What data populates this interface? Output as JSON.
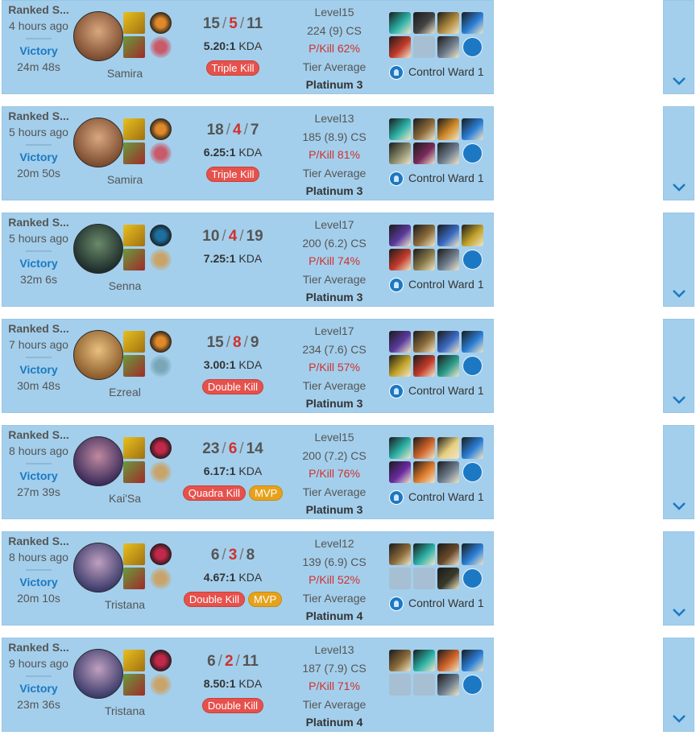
{
  "matches": [
    {
      "game_type": "Ranked S...",
      "time_ago": "4 hours ago",
      "result": "Victory",
      "length": "24m 48s",
      "champion": "Samira",
      "kills": "15",
      "deaths": "5",
      "assists": "11",
      "kda_ratio": "5.20:1",
      "kda_label": "KDA",
      "badges": [
        {
          "label": "Triple Kill",
          "kind": "multikill"
        }
      ],
      "level": "Level15",
      "cs": "224 (9) CS",
      "pkill": "P/Kill 62%",
      "tier_label": "Tier Average",
      "tier": "Platinum 3",
      "ward": "Control Ward 1",
      "spell_colors": [
        "#e8c020",
        "#6a9c3c"
      ],
      "rune_colors": [
        "#e0892a",
        "#c95a6a"
      ],
      "portrait_colors": [
        "#7a4a2e",
        "#d9a77f"
      ],
      "item_colors": [
        "#2bb0a5",
        "#444444",
        "#b08a3e",
        "#2b7fd6",
        "#c23a2a",
        "",
        "#6e7c8c"
      ]
    },
    {
      "game_type": "Ranked S...",
      "time_ago": "5 hours ago",
      "result": "Victory",
      "length": "20m 50s",
      "champion": "Samira",
      "kills": "18",
      "deaths": "4",
      "assists": "7",
      "kda_ratio": "6.25:1",
      "kda_label": "KDA",
      "badges": [
        {
          "label": "Triple Kill",
          "kind": "multikill"
        }
      ],
      "level": "Level13",
      "cs": "185 (8.9) CS",
      "pkill": "P/Kill 81%",
      "tier_label": "Tier Average",
      "tier": "Platinum 3",
      "ward": "Control Ward 1",
      "spell_colors": [
        "#e8c020",
        "#6a9c3c"
      ],
      "rune_colors": [
        "#e0892a",
        "#c95a6a"
      ],
      "portrait_colors": [
        "#7a4a2e",
        "#d9a77f"
      ],
      "item_colors": [
        "#2bb0a5",
        "#8a6a3a",
        "#d08a2a",
        "#2b7fd6",
        "#8a8a6a",
        "#7a2a5a",
        "#6e7c8c"
      ]
    },
    {
      "game_type": "Ranked S...",
      "time_ago": "5 hours ago",
      "result": "Victory",
      "length": "32m 6s",
      "champion": "Senna",
      "kills": "10",
      "deaths": "4",
      "assists": "19",
      "kda_ratio": "7.25:1",
      "kda_label": "KDA",
      "badges": [],
      "level": "Level17",
      "cs": "200 (6.2) CS",
      "pkill": "P/Kill 74%",
      "tier_label": "Tier Average",
      "tier": "Platinum 3",
      "ward": "Control Ward 1",
      "spell_colors": [
        "#e8c020",
        "#6a9c3c"
      ],
      "rune_colors": [
        "#1e6fa0",
        "#c9a46a"
      ],
      "portrait_colors": [
        "#1c2b2a",
        "#6a8a6a"
      ],
      "item_colors": [
        "#5a3a9c",
        "#8a6a3a",
        "#3a6ac2",
        "#c2a22a",
        "#c23a2a",
        "#8a7a4a",
        "#6e7c8c"
      ]
    },
    {
      "game_type": "Ranked S...",
      "time_ago": "7 hours ago",
      "result": "Victory",
      "length": "30m 48s",
      "champion": "Ezreal",
      "kills": "15",
      "deaths": "8",
      "assists": "9",
      "kda_ratio": "3.00:1",
      "kda_label": "KDA",
      "badges": [
        {
          "label": "Double Kill",
          "kind": "multikill"
        }
      ],
      "level": "Level17",
      "cs": "234 (7.6) CS",
      "pkill": "P/Kill 57%",
      "tier_label": "Tier Average",
      "tier": "Platinum 3",
      "ward": "Control Ward 1",
      "spell_colors": [
        "#e8c020",
        "#6a9c3c"
      ],
      "rune_colors": [
        "#e0892a",
        "#7aa6b8"
      ],
      "portrait_colors": [
        "#8a5a2a",
        "#e8c080"
      ],
      "item_colors": [
        "#5a3a9c",
        "#8a6a3a",
        "#3a6ac2",
        "#2b7fd6",
        "#c2a22a",
        "#c23a2a",
        "#2a9a8a"
      ]
    },
    {
      "game_type": "Ranked S...",
      "time_ago": "8 hours ago",
      "result": "Victory",
      "length": "27m 39s",
      "champion": "Kai'Sa",
      "kills": "23",
      "deaths": "6",
      "assists": "14",
      "kda_ratio": "6.17:1",
      "kda_label": "KDA",
      "badges": [
        {
          "label": "Quadra Kill",
          "kind": "multikill"
        },
        {
          "label": "MVP",
          "kind": "mvp"
        }
      ],
      "level": "Level15",
      "cs": "200 (7.2) CS",
      "pkill": "P/Kill 76%",
      "tier_label": "Tier Average",
      "tier": "Platinum 3",
      "ward": "Control Ward 1",
      "spell_colors": [
        "#e8c020",
        "#6a9c3c"
      ],
      "rune_colors": [
        "#c2284a",
        "#c9a46a"
      ],
      "portrait_colors": [
        "#3a2a5a",
        "#c08aa0"
      ],
      "item_colors": [
        "#2bb0a5",
        "#d0642a",
        "#e8d080",
        "#2b7fd6",
        "#6a2aa0",
        "#e07a2a",
        "#6e7c8c"
      ]
    },
    {
      "game_type": "Ranked S...",
      "time_ago": "8 hours ago",
      "result": "Victory",
      "length": "20m 10s",
      "champion": "Tristana",
      "kills": "6",
      "deaths": "3",
      "assists": "8",
      "kda_ratio": "4.67:1",
      "kda_label": "KDA",
      "badges": [
        {
          "label": "Double Kill",
          "kind": "multikill"
        },
        {
          "label": "MVP",
          "kind": "mvp"
        }
      ],
      "level": "Level12",
      "cs": "139 (6.9) CS",
      "pkill": "P/Kill 52%",
      "tier_label": "Tier Average",
      "tier": "Platinum 4",
      "ward": "Control Ward 1",
      "spell_colors": [
        "#e8c020",
        "#6a9c3c"
      ],
      "rune_colors": [
        "#c2284a",
        "#c9a46a"
      ],
      "portrait_colors": [
        "#3a3a6a",
        "#c0a0c0"
      ],
      "item_colors": [
        "#8a6a3a",
        "#2bb0a5",
        "#6a4a2a",
        "#2b7fd6",
        "",
        "",
        "#3a3a2a"
      ]
    },
    {
      "game_type": "Ranked S...",
      "time_ago": "9 hours ago",
      "result": "Victory",
      "length": "23m 36s",
      "champion": "Tristana",
      "kills": "6",
      "deaths": "2",
      "assists": "11",
      "kda_ratio": "8.50:1",
      "kda_label": "KDA",
      "badges": [
        {
          "label": "Double Kill",
          "kind": "multikill"
        }
      ],
      "level": "Level13",
      "cs": "187 (7.9) CS",
      "pkill": "P/Kill 71%",
      "tier_label": "Tier Average",
      "tier": "Platinum 4",
      "ward": "",
      "spell_colors": [
        "#e8c020",
        "#6a9c3c"
      ],
      "rune_colors": [
        "#c2284a",
        "#c9a46a"
      ],
      "portrait_colors": [
        "#3a3a6a",
        "#c0a0c0"
      ],
      "item_colors": [
        "#8a6a3a",
        "#2bb0a5",
        "#d0642a",
        "#2b7fd6",
        "",
        "",
        "#6e7c8c"
      ]
    }
  ]
}
